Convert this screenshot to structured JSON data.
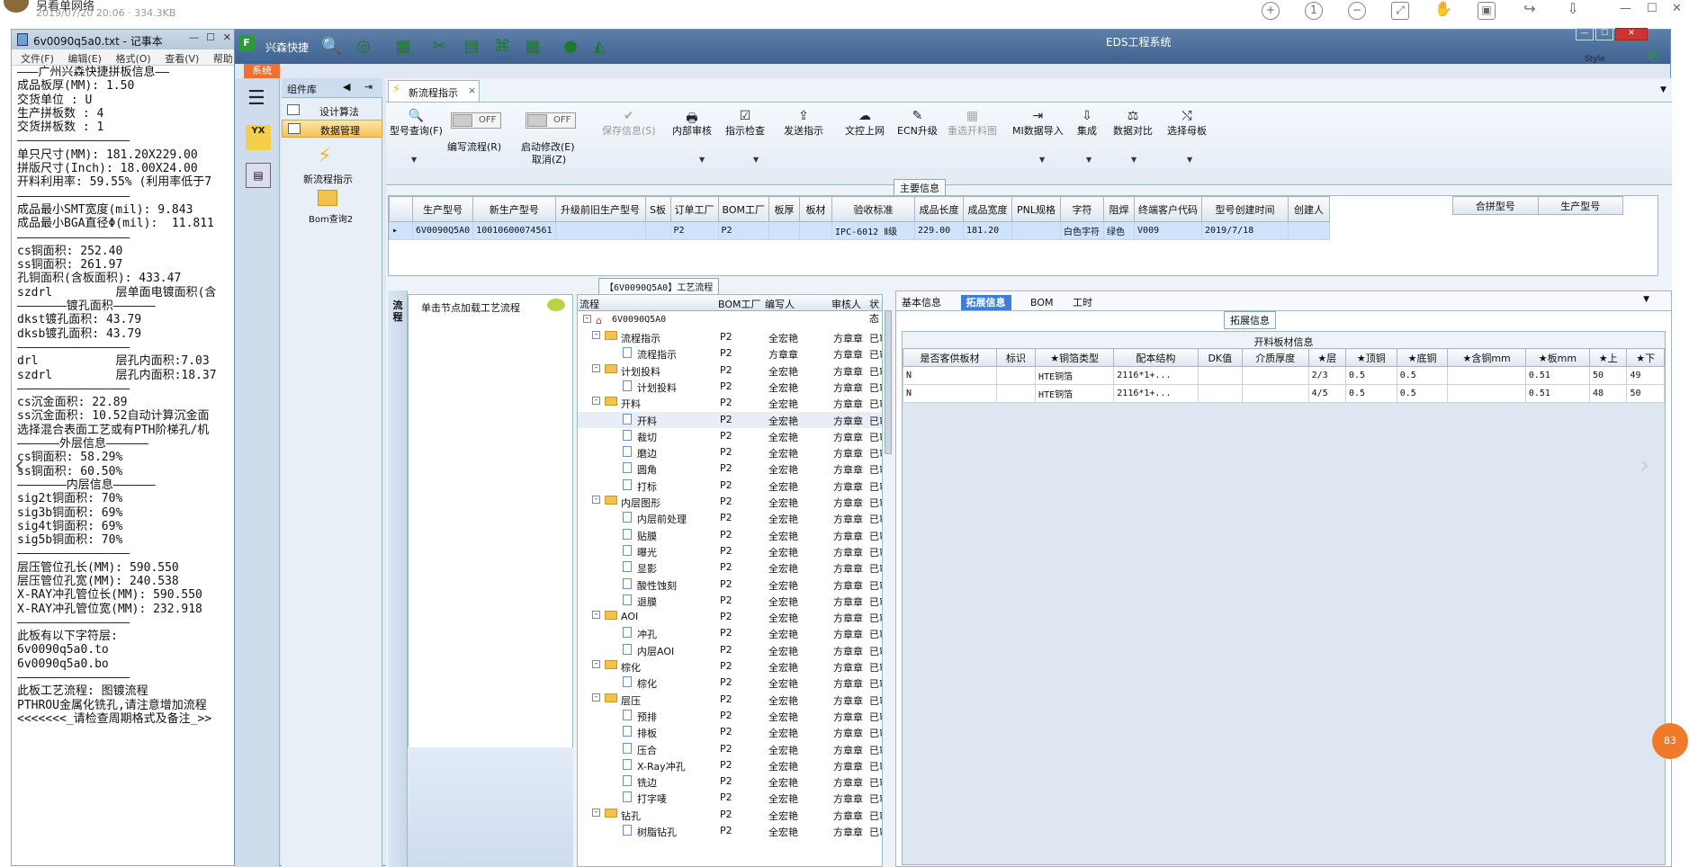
{
  "viewer": {
    "title": "另看单网络",
    "meta": "2019/07/20 20:06 · 334.3KB"
  },
  "notepad": {
    "title": "6v0090q5a0.txt - 记事本",
    "menu": [
      "文件(F)",
      "编辑(E)",
      "格式(O)",
      "查看(V)",
      "帮助"
    ],
    "lines": [
      "———广州兴森快捷拼板信息——",
      "成品板厚(MM): 1.50",
      "交货单位 : U",
      "生产拼板数 : 4",
      "交货拼板数 : 1",
      "————————————————",
      "单只尺寸(MM): 181.20X229.00",
      "拼版尺寸(Inch): 18.00X24.00",
      "开料利用率: 59.55% (利用率低于7",
      "————————————————",
      "成品最小SMT宽度(mil): 9.843",
      "成品最小BGA直径Φ(mil):  11.811",
      "————————————————",
      "cs铜面积: 252.40",
      "ss铜面积: 261.97",
      "孔铜面积(含板面积): 433.47",
      "szdrl         层单面电镀面积(含",
      "",
      "———————镀孔面积——————",
      "dkst镀孔面积: 43.79",
      "dksb镀孔面积: 43.79",
      "",
      "————————————————",
      "drl           层孔内面积:7.03",
      "szdrl         层孔内面积:18.37",
      "",
      "————————————————",
      "cs沉金面积: 22.89",
      "ss沉金面积: 10.52自动计算沉金面",
      "选择混合表面工艺或有PTH阶梯孔/机",
      "——————外层信息——————",
      "cs铜面积: 58.29%",
      "ss铜面积: 60.50%",
      "———————内层信息——————",
      "sig2t铜面积: 70%",
      "sig3b铜面积: 69%",
      "sig4t铜面积: 69%",
      "sig5b铜面积: 70%",
      "————————————————",
      "层压管位孔长(MM): 590.550",
      "层压管位孔宽(MM): 240.538",
      "",
      "X-RAY冲孔管位长(MM): 590.550",
      "X-RAY冲孔管位宽(MM): 232.918",
      "",
      "————————————————",
      "此板有以下字符层:",
      "6v0090q5a0.to",
      "6v0090q5a0.bo",
      "————————————————",
      "此板工艺流程: 图镀流程",
      "PTHROU金属化铣孔,请注意增加流程",
      "<<<<<<<_请检查周期格式及备注_>>"
    ]
  },
  "eds": {
    "title": "EDS工程系统",
    "quick_label": "兴森快捷",
    "sys_tab": "系统",
    "style_label": "Style",
    "complib": {
      "title": "组件库",
      "items": [
        "设计算法",
        "数据管理"
      ],
      "tools": [
        "新流程指示",
        "Bom查询2"
      ]
    },
    "doc_tab": "新流程指示",
    "toolbar": [
      {
        "label": "型号查询(F)",
        "icon": "🔍",
        "dd": true,
        "disabled": false
      },
      {
        "label": "编写流程(R)",
        "toggle": "OFF"
      },
      {
        "label": "启动修改(E)",
        "sub": "取消(Z)",
        "toggle": "OFF"
      },
      {
        "label": "保存信息(S)",
        "icon": "✔",
        "disabled": true
      },
      {
        "label": "内部审核",
        "icon": "🖶",
        "dd": true
      },
      {
        "label": "指示检查",
        "icon": "☑",
        "dd": true
      },
      {
        "label": "发送指示",
        "icon": "⇪"
      },
      {
        "label": "文控上网",
        "icon": "☁"
      },
      {
        "label": "ECN升级",
        "icon": "✎"
      },
      {
        "label": "重选开料图",
        "icon": "▦",
        "disabled": true
      },
      {
        "label": "MI数据导入",
        "icon": "⇥",
        "dd": true
      },
      {
        "label": "集成",
        "icon": "⇩",
        "dd": true
      },
      {
        "label": "数据对比",
        "icon": "⚖",
        "dd": true
      },
      {
        "label": "选择母板",
        "icon": "⤭",
        "dd": true
      }
    ],
    "main_info": {
      "label": "主要信息",
      "headers": [
        "生产型号",
        "新生产型号",
        "升级前旧生产型号",
        "S板",
        "订单工厂",
        "BOM工厂",
        "板厚",
        "板材",
        "验收标准",
        "成品长度",
        "成品宽度",
        "PNL规格",
        "字符",
        "阻焊",
        "终端客户代码",
        "型号创建时间",
        "创建人"
      ],
      "row": [
        "6V0090Q5A0",
        "10010600074561",
        "",
        "",
        "P2",
        "P2",
        "",
        "",
        "IPC-6012 Ⅱ级",
        "229.00",
        "181.20",
        "",
        "白色字符",
        "绿色",
        "V009",
        "2019/7/18",
        ""
      ],
      "side_headers": [
        "合拼型号",
        "生产型号"
      ]
    },
    "process": {
      "label": "【6V0090Q5A0】工艺流程",
      "vtab": "流程",
      "load_btn": "单击节点加载工艺流程",
      "headers": [
        "流程",
        "BOM工厂",
        "编写人",
        "审核人",
        "状态"
      ],
      "root": "6V0090Q5A0",
      "rows": [
        {
          "lvl": 1,
          "name": "流程指示",
          "f": "P2",
          "w": "全宏艳",
          "a": "方章章",
          "s": "已审核"
        },
        {
          "lvl": 2,
          "name": "流程指示",
          "f": "P2",
          "w": "方章章",
          "a": "方章章",
          "s": "已审核"
        },
        {
          "lvl": 1,
          "name": "计划投料",
          "f": "P2",
          "w": "全宏艳",
          "a": "方章章",
          "s": "已审核"
        },
        {
          "lvl": 2,
          "name": "计划投料",
          "f": "P2",
          "w": "全宏艳",
          "a": "方章章",
          "s": "已审核"
        },
        {
          "lvl": 1,
          "name": "开料",
          "f": "P2",
          "w": "全宏艳",
          "a": "方章章",
          "s": "已审核"
        },
        {
          "lvl": 2,
          "name": "开料",
          "f": "P2",
          "w": "全宏艳",
          "a": "方章章",
          "s": "已审核"
        },
        {
          "lvl": 2,
          "name": "裁切",
          "f": "P2",
          "w": "全宏艳",
          "a": "方章章",
          "s": "已审核"
        },
        {
          "lvl": 2,
          "name": "磨边",
          "f": "P2",
          "w": "全宏艳",
          "a": "方章章",
          "s": "已审核"
        },
        {
          "lvl": 2,
          "name": "圆角",
          "f": "P2",
          "w": "全宏艳",
          "a": "方章章",
          "s": "已审核"
        },
        {
          "lvl": 2,
          "name": "打标",
          "f": "P2",
          "w": "全宏艳",
          "a": "方章章",
          "s": "已审核"
        },
        {
          "lvl": 1,
          "name": "内层图形",
          "f": "P2",
          "w": "全宏艳",
          "a": "方章章",
          "s": "已审核"
        },
        {
          "lvl": 2,
          "name": "内层前处理",
          "f": "P2",
          "w": "全宏艳",
          "a": "方章章",
          "s": "已审核"
        },
        {
          "lvl": 2,
          "name": "贴膜",
          "f": "P2",
          "w": "全宏艳",
          "a": "方章章",
          "s": "已审核"
        },
        {
          "lvl": 2,
          "name": "曝光",
          "f": "P2",
          "w": "全宏艳",
          "a": "方章章",
          "s": "已审核"
        },
        {
          "lvl": 2,
          "name": "显影",
          "f": "P2",
          "w": "全宏艳",
          "a": "方章章",
          "s": "已审核"
        },
        {
          "lvl": 2,
          "name": "酸性蚀刻",
          "f": "P2",
          "w": "全宏艳",
          "a": "方章章",
          "s": "已审核"
        },
        {
          "lvl": 2,
          "name": "退膜",
          "f": "P2",
          "w": "全宏艳",
          "a": "方章章",
          "s": "已审核"
        },
        {
          "lvl": 1,
          "name": "AOI",
          "f": "P2",
          "w": "全宏艳",
          "a": "方章章",
          "s": "已审核"
        },
        {
          "lvl": 2,
          "name": "冲孔",
          "f": "P2",
          "w": "全宏艳",
          "a": "方章章",
          "s": "已审核"
        },
        {
          "lvl": 2,
          "name": "内层AOI",
          "f": "P2",
          "w": "全宏艳",
          "a": "方章章",
          "s": "已审核"
        },
        {
          "lvl": 1,
          "name": "棕化",
          "f": "P2",
          "w": "全宏艳",
          "a": "方章章",
          "s": "已审核"
        },
        {
          "lvl": 2,
          "name": "棕化",
          "f": "P2",
          "w": "全宏艳",
          "a": "方章章",
          "s": "已审核"
        },
        {
          "lvl": 1,
          "name": "层压",
          "f": "P2",
          "w": "全宏艳",
          "a": "方章章",
          "s": "已审核"
        },
        {
          "lvl": 2,
          "name": "预排",
          "f": "P2",
          "w": "全宏艳",
          "a": "方章章",
          "s": "已审核"
        },
        {
          "lvl": 2,
          "name": "排板",
          "f": "P2",
          "w": "全宏艳",
          "a": "方章章",
          "s": "已审核"
        },
        {
          "lvl": 2,
          "name": "压合",
          "f": "P2",
          "w": "全宏艳",
          "a": "方章章",
          "s": "已审核"
        },
        {
          "lvl": 2,
          "name": "X-Ray冲孔",
          "f": "P2",
          "w": "全宏艳",
          "a": "方章章",
          "s": "已审核"
        },
        {
          "lvl": 2,
          "name": "铣边",
          "f": "P2",
          "w": "全宏艳",
          "a": "方章章",
          "s": "已审核"
        },
        {
          "lvl": 2,
          "name": "打字唛",
          "f": "P2",
          "w": "全宏艳",
          "a": "方章章",
          "s": "已审核"
        },
        {
          "lvl": 1,
          "name": "钻孔",
          "f": "P2",
          "w": "全宏艳",
          "a": "方章章",
          "s": "已审核"
        },
        {
          "lvl": 2,
          "name": "树脂钻孔",
          "f": "P2",
          "w": "全宏艳",
          "a": "方章章",
          "s": "已审核"
        }
      ]
    },
    "right_panel": {
      "tabs": [
        "基本信息",
        "拓展信息",
        "BOM",
        "工时"
      ],
      "active_tab": "拓展信息",
      "section": "拓展信息",
      "table_title": "开料板材信息",
      "headers": [
        "是否客供板材",
        "标识",
        "★铜箔类型",
        "配本结构",
        "DK值",
        "介质厚度",
        "★层",
        "★顶铜",
        "★底铜",
        "★含铜mm",
        "★板mm",
        "★上",
        "★下"
      ],
      "rows": [
        [
          "N",
          "",
          "HTE铜箔",
          "2116*1+...",
          "",
          "",
          "2/3",
          "0.5",
          "0.5",
          "",
          "0.51",
          "50",
          "49"
        ],
        [
          "N",
          "",
          "HTE铜箔",
          "2116*1+...",
          "",
          "",
          "4/5",
          "0.5",
          "0.5",
          "",
          "0.51",
          "48",
          "50"
        ]
      ]
    }
  },
  "badge": "83"
}
